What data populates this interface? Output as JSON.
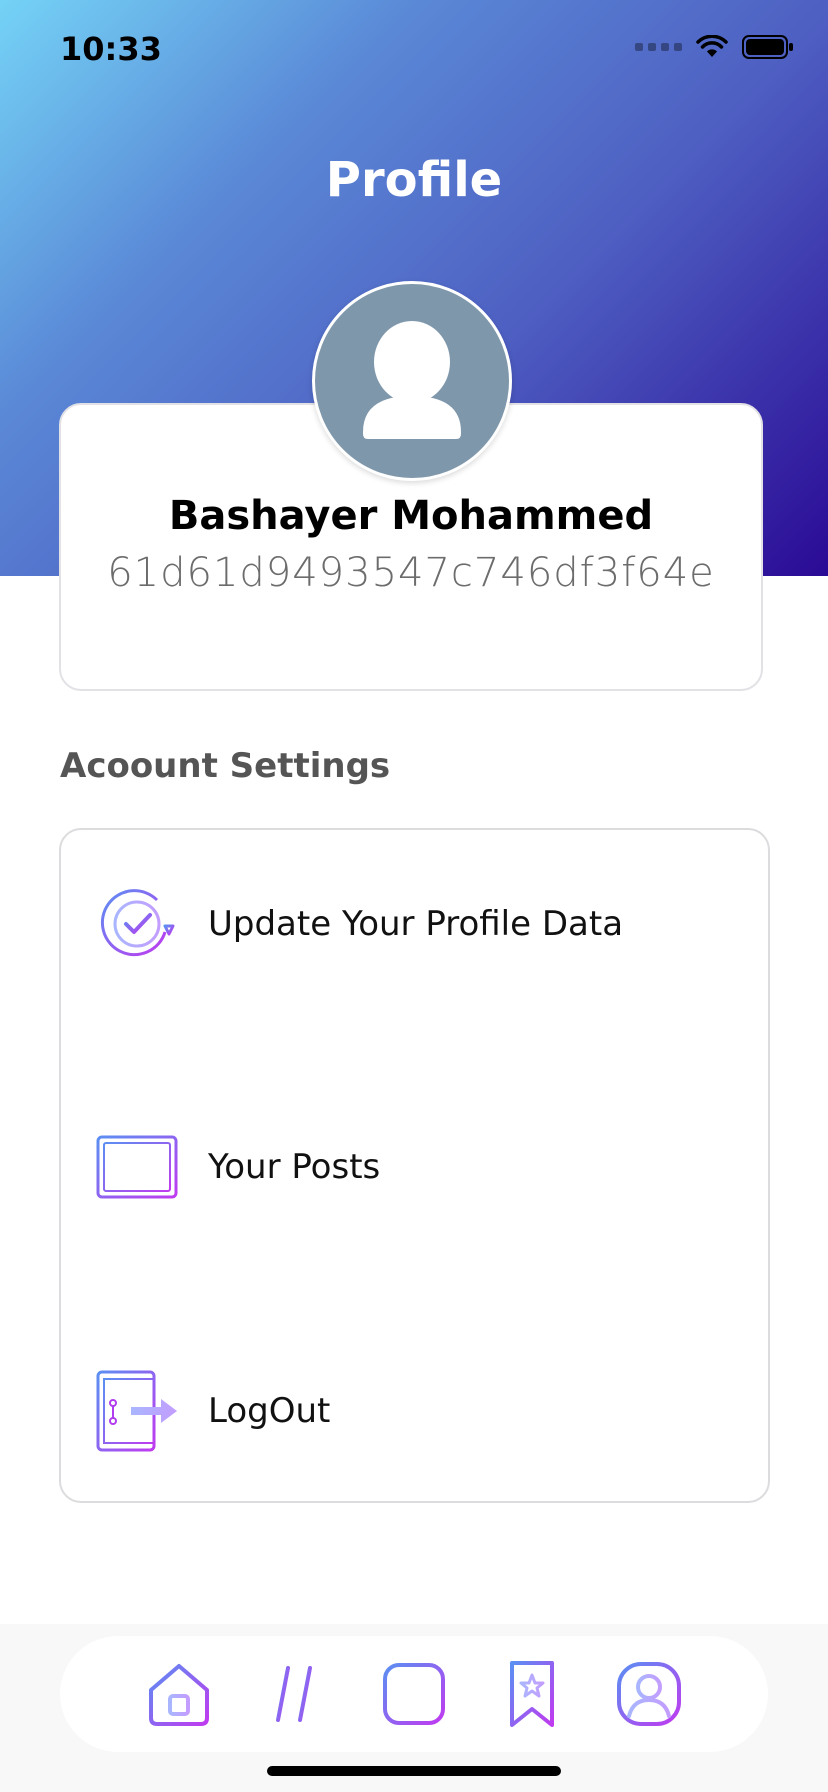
{
  "status_bar": {
    "time": "10:33"
  },
  "header": {
    "title": "Profile"
  },
  "profile": {
    "name": "Bashayer Mohammed",
    "id": "61d61d9493547c746df3f64e"
  },
  "settings": {
    "section_title": "Acoount Settings",
    "items": [
      {
        "label": "Update Your Profile Data",
        "icon": "update-profile-icon"
      },
      {
        "label": "Your Posts",
        "icon": "posts-icon"
      },
      {
        "label": "LogOut",
        "icon": "logout-icon"
      }
    ]
  },
  "bottom_nav": {
    "items": [
      "home-icon",
      "hashtag-icon",
      "add-icon",
      "bookmark-icon",
      "profile-icon"
    ]
  },
  "colors": {
    "gradient_start": "#74d3f6",
    "gradient_end": "#2a0a95",
    "icon_blue": "#5b8ff2",
    "icon_purple": "#b13cf0"
  }
}
